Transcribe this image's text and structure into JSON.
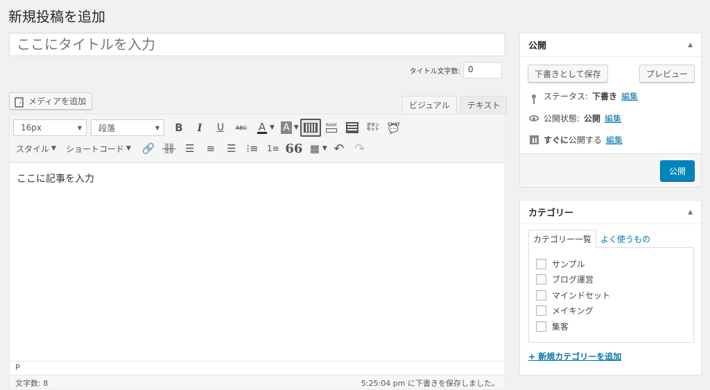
{
  "page": {
    "title": "新規投稿を追加"
  },
  "title_field": {
    "placeholder": "ここにタイトルを入力",
    "char_count_label": "タイトル文字数:",
    "char_count_value": "0"
  },
  "media": {
    "add_media_label": "メディアを追加"
  },
  "editor": {
    "tabs": [
      {
        "label": "ビジュアル",
        "active": true
      },
      {
        "label": "テキスト",
        "active": false
      }
    ],
    "toolbar": {
      "font_size": "16px",
      "format": "段落",
      "bold": "B",
      "italic": "I",
      "underline": "U",
      "strikethrough": "ABC",
      "text_color": "A",
      "bg_color": "A",
      "rank_label": "RANK",
      "button_label_1": "ボタン",
      "button_label_2": "セット",
      "chat_label": "CHAT",
      "style_label": "スタイル",
      "shortcode_label": "ショートコード",
      "quote": "66"
    },
    "content": "ここに記事を入力",
    "path": "P",
    "word_count": "文字数: 8",
    "autosave": "5:25:04 pm に下書きを保存しました。"
  },
  "publish_box": {
    "title": "公開",
    "save_draft": "下書きとして保存",
    "preview": "プレビュー",
    "status_label": "ステータス:",
    "status_value": "下書き",
    "visibility_label": "公開状態:",
    "visibility_value": "公開",
    "schedule_bold": "すぐに",
    "schedule_text": "公開する",
    "edit": "編集",
    "publish": "公開"
  },
  "category_box": {
    "title": "カテゴリー",
    "tabs": [
      {
        "label": "カテゴリー一覧",
        "active": true
      },
      {
        "label": "よく使うもの",
        "active": false
      }
    ],
    "items": [
      "サンプル",
      "ブログ運営",
      "マインドセット",
      "メイキング",
      "集客"
    ],
    "add_new": "+ 新規カテゴリーを追加"
  },
  "colors": {
    "accent": "#0073aa",
    "primary_button": "#0085ba",
    "background": "#f1f1f1"
  }
}
